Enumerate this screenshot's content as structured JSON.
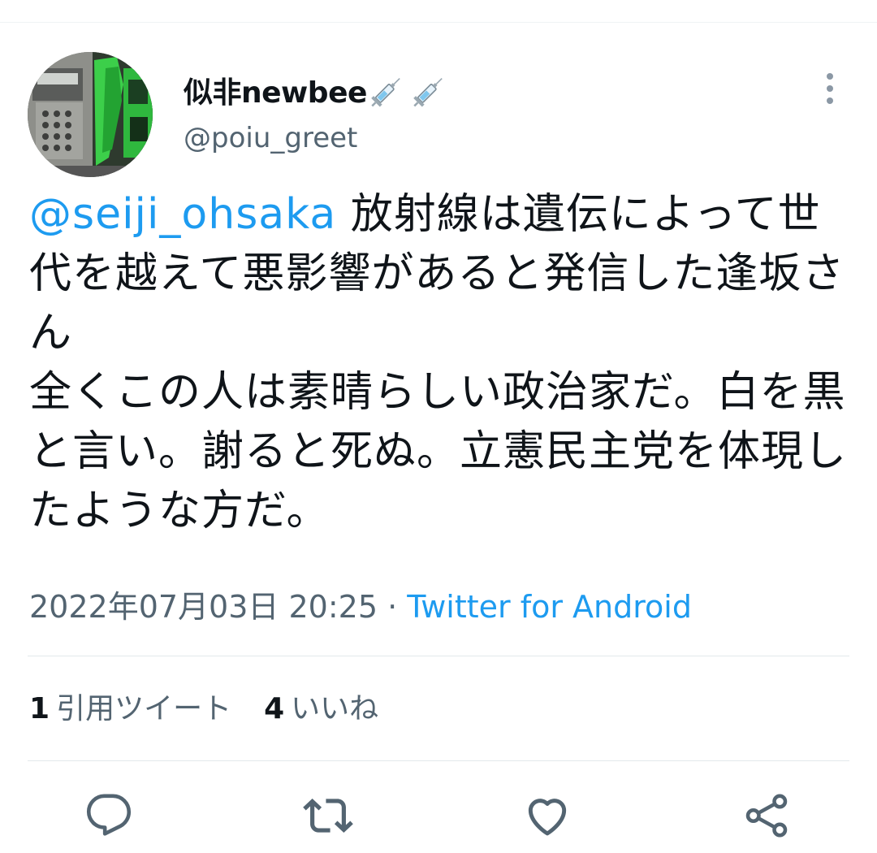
{
  "author": {
    "display_name": "似非newbee",
    "badges": [
      "syringe-icon",
      "syringe-icon"
    ],
    "handle": "@poiu_greet"
  },
  "tweet": {
    "mention": "@seiji_ohsaka",
    "text": " 放射線は遺伝によって世代を越えて悪影響があると発信した逢坂さん\n全くこの人は素晴らしい政治家だ。白を黒と言い。謝ると死ぬ。立憲民主党を体現したような方だ。"
  },
  "meta": {
    "timestamp": "2022年07月03日 20:25",
    "separator": " · ",
    "source": "Twitter for Android"
  },
  "stats": {
    "quotes_count": "1",
    "quotes_label": "引用ツイート",
    "likes_count": "4",
    "likes_label": "いいね"
  },
  "actions": [
    "reply-icon",
    "retweet-icon",
    "like-icon",
    "share-icon"
  ],
  "colors": {
    "accent": "#1d9bf0",
    "text": "#0f1419",
    "secondary": "#536471",
    "divider": "#e3e8eb"
  }
}
